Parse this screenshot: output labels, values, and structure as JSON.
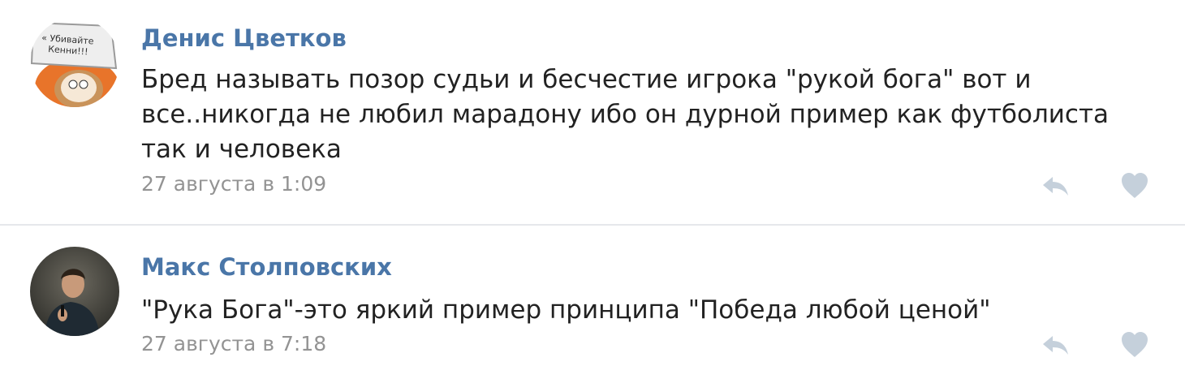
{
  "comments": [
    {
      "author": "Денис Цветков",
      "avatar_sign_text": [
        "« Убивайте",
        "Кенни!!!"
      ],
      "text_lines": [
        "Бред называть позор судьи и бесчестие игрока \"рукой бога\" вот и",
        "все..никогда не любил марадону ибо он дурной пример как футболиста",
        "так и человека"
      ],
      "date": "27 августа в 1:09",
      "reply_icon": "reply-arrow-icon",
      "like_icon": "heart-icon"
    },
    {
      "author": "Макс Столповских",
      "text_lines": [
        "\"Рука Бога\"-это яркий пример принципа \"Победа любой ценой\""
      ],
      "date": "27 августа в 7:18",
      "reply_icon": "reply-arrow-icon",
      "like_icon": "heart-icon"
    }
  ],
  "colors": {
    "author": "#4a76a8",
    "text": "#222222",
    "date": "#939393",
    "icons": "#c5d0db",
    "divider": "#e6e8eb"
  }
}
